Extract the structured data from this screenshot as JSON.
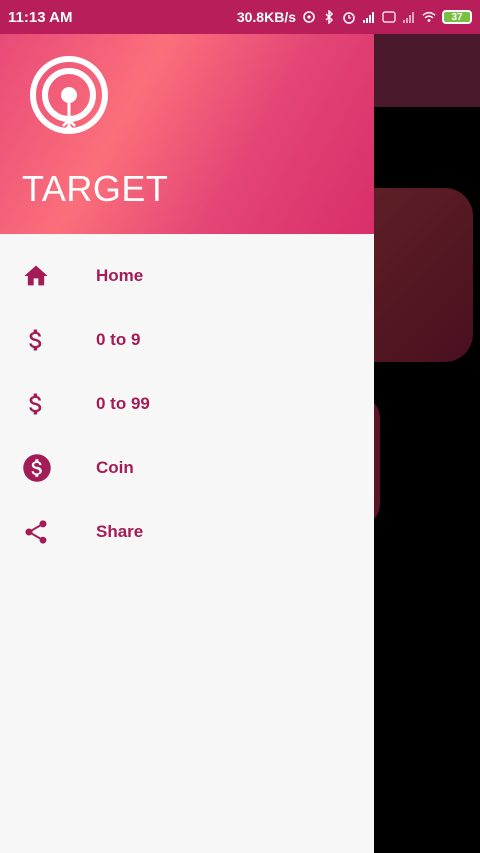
{
  "status_bar": {
    "time": "11:13 AM",
    "net_speed": "30.8KB/s",
    "battery": "37"
  },
  "drawer": {
    "title": "TARGET",
    "items": [
      {
        "label": "Home",
        "icon": "home-icon"
      },
      {
        "label": "0 to 9",
        "icon": "dollar-icon"
      },
      {
        "label": "0 to 99",
        "icon": "dollar-icon"
      },
      {
        "label": "Coin",
        "icon": "coin-icon"
      },
      {
        "label": "Share",
        "icon": "share-icon"
      }
    ]
  },
  "colors": {
    "accent": "#a41c57",
    "header_start": "#e84a78",
    "header_end": "#d92e6a"
  }
}
